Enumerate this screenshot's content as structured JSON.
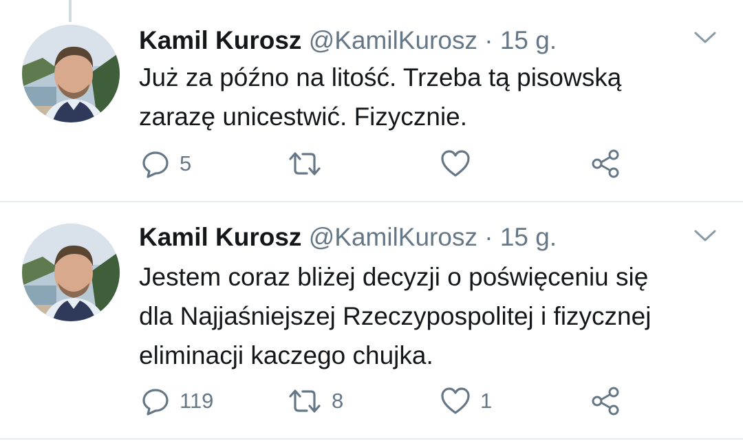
{
  "tweets": [
    {
      "name": "Kamil Kurosz",
      "handle": "@KamilKurosz",
      "separator": "·",
      "time": "15 g.",
      "text_lines": [
        "Już za późno na litość. Trzeba tą pisowską",
        "zarazę unicestwić. Fizycznie."
      ],
      "replies": "5",
      "retweets": "",
      "likes": ""
    },
    {
      "name": "Kamil Kurosz",
      "handle": "@KamilKurosz",
      "separator": "·",
      "time": "15 g.",
      "text_lines": [
        "Jestem coraz bliżej decyzji o poświęceniu się",
        "dla Najjaśniejszej Rzeczypospolitej i fizycznej",
        "eliminacji kaczego chujka."
      ],
      "replies": "119",
      "retweets": "8",
      "likes": "1"
    }
  ],
  "icons": {
    "reply": "reply-icon",
    "retweet": "retweet-icon",
    "like": "heart-icon",
    "share": "share-icon",
    "caret": "chevron-down-icon"
  },
  "colors": {
    "text": "#14171a",
    "secondary": "#657786",
    "divider": "#e6ecf0"
  }
}
